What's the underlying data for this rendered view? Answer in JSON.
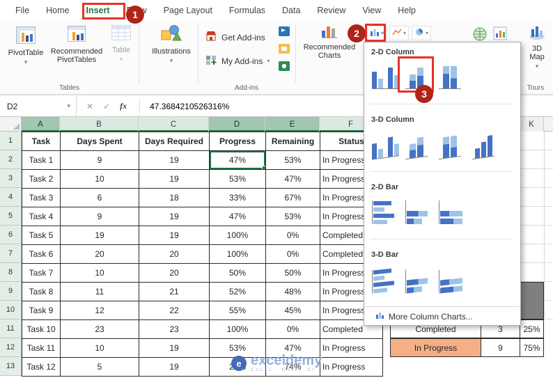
{
  "colors": {
    "excel_green": "#217346",
    "annotation_red": "#C00000",
    "chart_blue": "#4472C4",
    "chart_light_blue": "#9DC3E6",
    "summary_orange": "#F4B084"
  },
  "ribbon": {
    "tabs": [
      "File",
      "Home",
      "Insert",
      "Draw",
      "Page Layout",
      "Formulas",
      "Data",
      "Review",
      "View",
      "Help"
    ],
    "active_tab": "Insert",
    "tables_group": {
      "label": "Tables",
      "pivottable": "PivotTable",
      "recommended_pivottables": "Recommended PivotTables",
      "table": "Table"
    },
    "illustrations_group": {
      "button": "Illustrations"
    },
    "addins_group": {
      "label": "Add-ins",
      "get_addins": "Get Add-ins",
      "my_addins": "My Add-ins"
    },
    "charts_group": {
      "recommended_charts": "Recommended Charts"
    },
    "tours_group": {
      "label": "Tours",
      "map_3d": "3D Map"
    }
  },
  "formula_bar": {
    "name_box": "D2",
    "formula": "47.3684210526316%"
  },
  "chart_menu": {
    "sections": [
      {
        "title": "2-D Column"
      },
      {
        "title": "3-D Column"
      },
      {
        "title": "2-D Bar"
      },
      {
        "title": "3-D Bar"
      }
    ],
    "footer": "More Column Charts..."
  },
  "annotations": {
    "step_1": "1",
    "step_2": "2",
    "step_3": "3"
  },
  "sheet": {
    "col_headers": [
      "A",
      "B",
      "C",
      "D",
      "E",
      "F",
      "K"
    ],
    "row_headers": [
      "1",
      "2",
      "3",
      "4",
      "5",
      "6",
      "7",
      "8",
      "9",
      "10",
      "11",
      "12",
      "13"
    ],
    "active_cell": "D2",
    "table": {
      "headers": [
        "Task",
        "Days Spent",
        "Days Required",
        "Progress",
        "Remaining",
        "Status"
      ],
      "rows": [
        [
          "Task 1",
          "9",
          "19",
          "47%",
          "53%",
          "In Progress"
        ],
        [
          "Task 2",
          "10",
          "19",
          "53%",
          "47%",
          "In Progress"
        ],
        [
          "Task 3",
          "6",
          "18",
          "33%",
          "67%",
          "In Progress"
        ],
        [
          "Task 4",
          "9",
          "19",
          "47%",
          "53%",
          "In Progress"
        ],
        [
          "Task 5",
          "19",
          "19",
          "100%",
          "0%",
          "Completed"
        ],
        [
          "Task 6",
          "20",
          "20",
          "100%",
          "0%",
          "Completed"
        ],
        [
          "Task 7",
          "10",
          "20",
          "50%",
          "50%",
          "In Progress"
        ],
        [
          "Task 8",
          "11",
          "21",
          "52%",
          "48%",
          "In Progress"
        ],
        [
          "Task 9",
          "12",
          "22",
          "55%",
          "45%",
          "In Progress"
        ],
        [
          "Task 10",
          "23",
          "23",
          "100%",
          "0%",
          "Completed"
        ],
        [
          "Task 11",
          "10",
          "19",
          "53%",
          "47%",
          "In Progress"
        ],
        [
          "Task 12",
          "5",
          "19",
          "26%",
          "74%",
          "In Progress"
        ]
      ]
    },
    "summary_table": {
      "rows": [
        {
          "label": "Completed",
          "count": "3",
          "pct": "25%"
        },
        {
          "label": "In Progress",
          "count": "9",
          "pct": "75%"
        }
      ]
    }
  },
  "watermark": {
    "brand": "exceldemy",
    "tagline": "EXCEL · DATA · BI"
  }
}
